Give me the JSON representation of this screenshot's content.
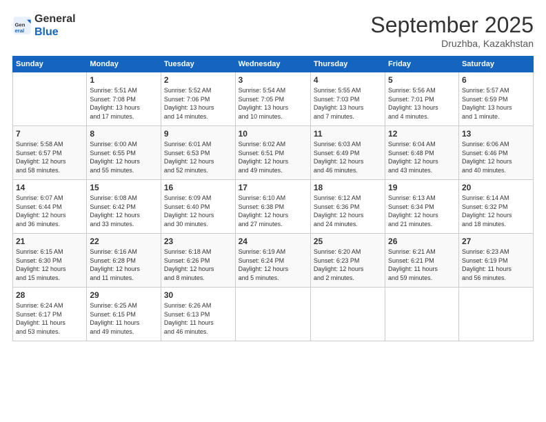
{
  "header": {
    "logo_general": "General",
    "logo_blue": "Blue",
    "month_title": "September 2025",
    "location": "Druzhba, Kazakhstan"
  },
  "columns": [
    "Sunday",
    "Monday",
    "Tuesday",
    "Wednesday",
    "Thursday",
    "Friday",
    "Saturday"
  ],
  "weeks": [
    [
      {
        "day": "",
        "content": ""
      },
      {
        "day": "1",
        "content": "Sunrise: 5:51 AM\nSunset: 7:08 PM\nDaylight: 13 hours\nand 17 minutes."
      },
      {
        "day": "2",
        "content": "Sunrise: 5:52 AM\nSunset: 7:06 PM\nDaylight: 13 hours\nand 14 minutes."
      },
      {
        "day": "3",
        "content": "Sunrise: 5:54 AM\nSunset: 7:05 PM\nDaylight: 13 hours\nand 10 minutes."
      },
      {
        "day": "4",
        "content": "Sunrise: 5:55 AM\nSunset: 7:03 PM\nDaylight: 13 hours\nand 7 minutes."
      },
      {
        "day": "5",
        "content": "Sunrise: 5:56 AM\nSunset: 7:01 PM\nDaylight: 13 hours\nand 4 minutes."
      },
      {
        "day": "6",
        "content": "Sunrise: 5:57 AM\nSunset: 6:59 PM\nDaylight: 13 hours\nand 1 minute."
      }
    ],
    [
      {
        "day": "7",
        "content": "Sunrise: 5:58 AM\nSunset: 6:57 PM\nDaylight: 12 hours\nand 58 minutes."
      },
      {
        "day": "8",
        "content": "Sunrise: 6:00 AM\nSunset: 6:55 PM\nDaylight: 12 hours\nand 55 minutes."
      },
      {
        "day": "9",
        "content": "Sunrise: 6:01 AM\nSunset: 6:53 PM\nDaylight: 12 hours\nand 52 minutes."
      },
      {
        "day": "10",
        "content": "Sunrise: 6:02 AM\nSunset: 6:51 PM\nDaylight: 12 hours\nand 49 minutes."
      },
      {
        "day": "11",
        "content": "Sunrise: 6:03 AM\nSunset: 6:49 PM\nDaylight: 12 hours\nand 46 minutes."
      },
      {
        "day": "12",
        "content": "Sunrise: 6:04 AM\nSunset: 6:48 PM\nDaylight: 12 hours\nand 43 minutes."
      },
      {
        "day": "13",
        "content": "Sunrise: 6:06 AM\nSunset: 6:46 PM\nDaylight: 12 hours\nand 40 minutes."
      }
    ],
    [
      {
        "day": "14",
        "content": "Sunrise: 6:07 AM\nSunset: 6:44 PM\nDaylight: 12 hours\nand 36 minutes."
      },
      {
        "day": "15",
        "content": "Sunrise: 6:08 AM\nSunset: 6:42 PM\nDaylight: 12 hours\nand 33 minutes."
      },
      {
        "day": "16",
        "content": "Sunrise: 6:09 AM\nSunset: 6:40 PM\nDaylight: 12 hours\nand 30 minutes."
      },
      {
        "day": "17",
        "content": "Sunrise: 6:10 AM\nSunset: 6:38 PM\nDaylight: 12 hours\nand 27 minutes."
      },
      {
        "day": "18",
        "content": "Sunrise: 6:12 AM\nSunset: 6:36 PM\nDaylight: 12 hours\nand 24 minutes."
      },
      {
        "day": "19",
        "content": "Sunrise: 6:13 AM\nSunset: 6:34 PM\nDaylight: 12 hours\nand 21 minutes."
      },
      {
        "day": "20",
        "content": "Sunrise: 6:14 AM\nSunset: 6:32 PM\nDaylight: 12 hours\nand 18 minutes."
      }
    ],
    [
      {
        "day": "21",
        "content": "Sunrise: 6:15 AM\nSunset: 6:30 PM\nDaylight: 12 hours\nand 15 minutes."
      },
      {
        "day": "22",
        "content": "Sunrise: 6:16 AM\nSunset: 6:28 PM\nDaylight: 12 hours\nand 11 minutes."
      },
      {
        "day": "23",
        "content": "Sunrise: 6:18 AM\nSunset: 6:26 PM\nDaylight: 12 hours\nand 8 minutes."
      },
      {
        "day": "24",
        "content": "Sunrise: 6:19 AM\nSunset: 6:24 PM\nDaylight: 12 hours\nand 5 minutes."
      },
      {
        "day": "25",
        "content": "Sunrise: 6:20 AM\nSunset: 6:23 PM\nDaylight: 12 hours\nand 2 minutes."
      },
      {
        "day": "26",
        "content": "Sunrise: 6:21 AM\nSunset: 6:21 PM\nDaylight: 11 hours\nand 59 minutes."
      },
      {
        "day": "27",
        "content": "Sunrise: 6:23 AM\nSunset: 6:19 PM\nDaylight: 11 hours\nand 56 minutes."
      }
    ],
    [
      {
        "day": "28",
        "content": "Sunrise: 6:24 AM\nSunset: 6:17 PM\nDaylight: 11 hours\nand 53 minutes."
      },
      {
        "day": "29",
        "content": "Sunrise: 6:25 AM\nSunset: 6:15 PM\nDaylight: 11 hours\nand 49 minutes."
      },
      {
        "day": "30",
        "content": "Sunrise: 6:26 AM\nSunset: 6:13 PM\nDaylight: 11 hours\nand 46 minutes."
      },
      {
        "day": "",
        "content": ""
      },
      {
        "day": "",
        "content": ""
      },
      {
        "day": "",
        "content": ""
      },
      {
        "day": "",
        "content": ""
      }
    ]
  ]
}
